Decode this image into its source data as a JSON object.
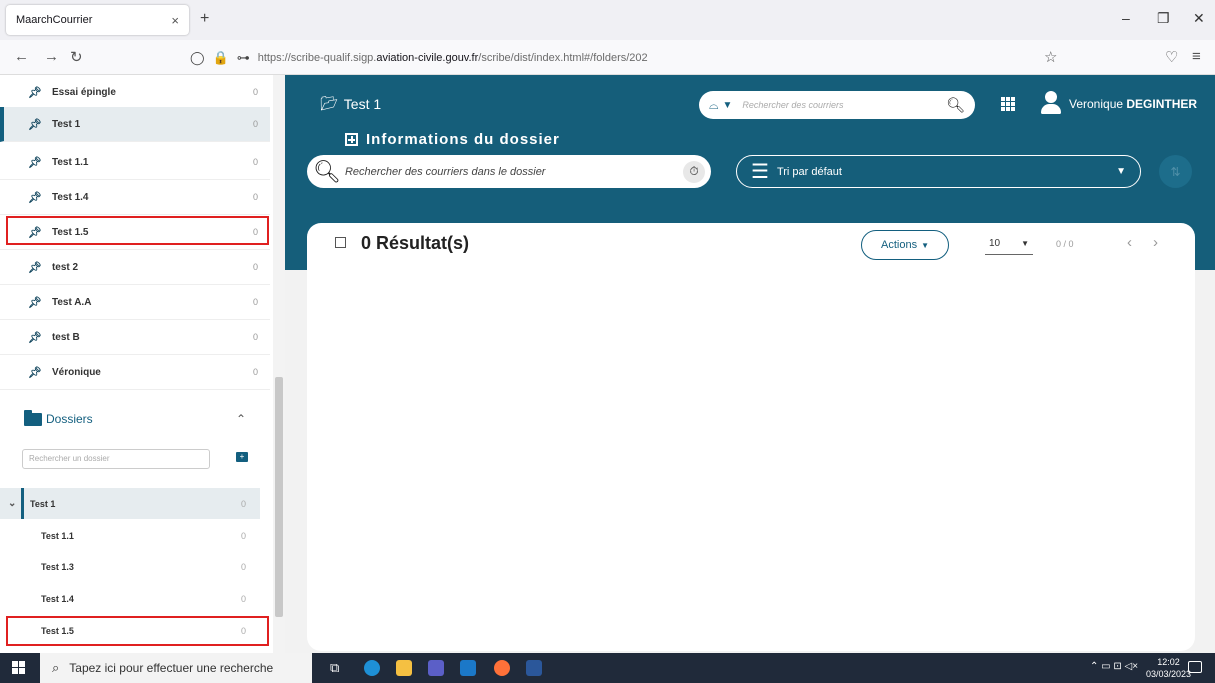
{
  "browser": {
    "tab_title": "MaarchCourrier",
    "tab_close": "×",
    "new_tab": "+",
    "url_prefix": "https://scribe-qualif.sigp.",
    "url_domain": "aviation-civile.gouv.fr",
    "url_suffix": "/scribe/dist/index.html#/folders/202"
  },
  "sidebar": {
    "pinned": [
      {
        "label": "Essai épingle",
        "count": "0"
      },
      {
        "label": "Test 1",
        "count": "0"
      },
      {
        "label": "Test 1.1",
        "count": "0"
      },
      {
        "label": "Test 1.4",
        "count": "0"
      },
      {
        "label": "Test 1.5",
        "count": "0"
      },
      {
        "label": "test 2",
        "count": "0"
      },
      {
        "label": "Test A.A",
        "count": "0"
      },
      {
        "label": "test B",
        "count": "0"
      },
      {
        "label": "Véronique",
        "count": "0"
      }
    ],
    "dossiers_title": "Dossiers",
    "search_placeholder": "Rechercher un dossier",
    "tree": [
      {
        "label": "Test 1",
        "count": "0"
      },
      {
        "label": "Test 1.1",
        "count": "0"
      },
      {
        "label": "Test 1.3",
        "count": "0"
      },
      {
        "label": "Test 1.4",
        "count": "0"
      },
      {
        "label": "Test 1.5",
        "count": "0"
      }
    ]
  },
  "header": {
    "breadcrumb": "Test 1",
    "search_placeholder": "Rechercher des courriers",
    "user_first": "Veronique",
    "user_last": "DEGINTHER",
    "info_title": "Informations du dossier"
  },
  "filters": {
    "folder_search_placeholder": "Rechercher des courriers dans le dossier",
    "sort_label": "Tri par défaut"
  },
  "results": {
    "title": "0 Résultat(s)",
    "actions_label": "Actions",
    "per_page": "10",
    "page_count": "0 / 0"
  },
  "taskbar": {
    "search_placeholder": "Tapez ici pour effectuer une recherche",
    "time": "12:02",
    "date": "03/03/2023"
  },
  "colors": {
    "brand": "#155e7a",
    "highlight": "#e02020"
  }
}
